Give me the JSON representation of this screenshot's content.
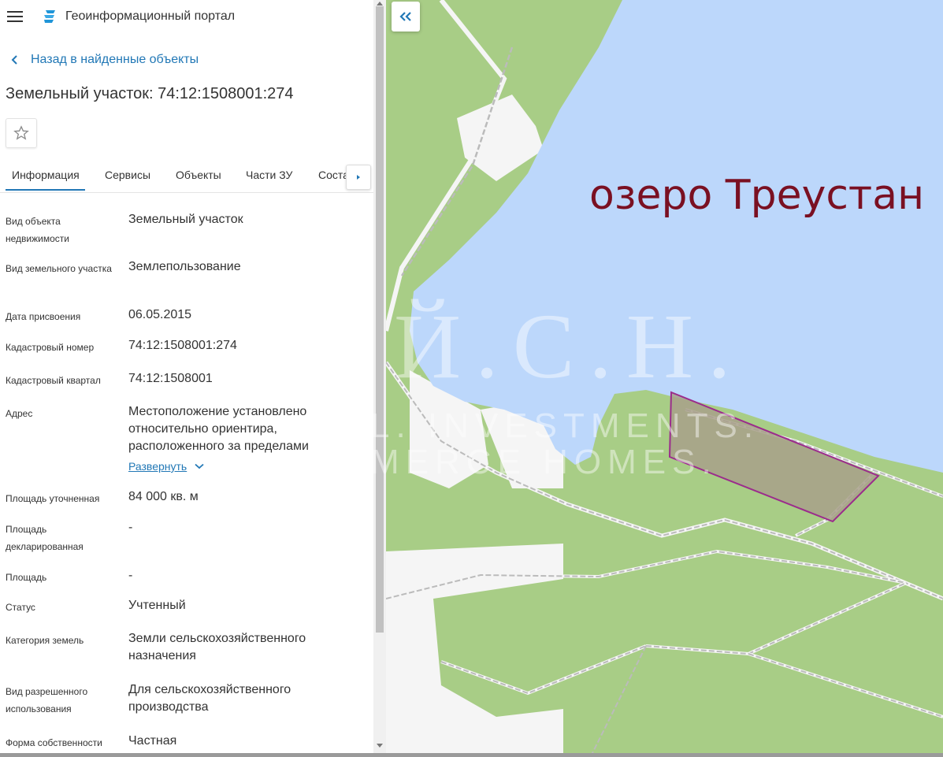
{
  "header": {
    "title": "Геоинформационный портал",
    "menu_icon": "hamburger-icon",
    "logo_icon": "portal-logo-icon"
  },
  "nav": {
    "back_label": "Назад в найденные объекты"
  },
  "object": {
    "title": "Земельный участок: 74:12:1508001:274"
  },
  "tabs": [
    {
      "label": "Информация",
      "active": true
    },
    {
      "label": "Сервисы"
    },
    {
      "label": "Объекты"
    },
    {
      "label": "Части ЗУ"
    },
    {
      "label": "Соста"
    }
  ],
  "fields": [
    {
      "label": "Вид объекта недвижимости",
      "value": "Земельный участок"
    },
    {
      "label": "Вид земельного участка",
      "value": "Землепользование"
    },
    {
      "label": "Дата присвоения",
      "value": "06.05.2015"
    },
    {
      "label": "Кадастровый номер",
      "value": "74:12:1508001:274"
    },
    {
      "label": "Кадастровый квартал",
      "value": "74:12:1508001"
    },
    {
      "label": "Адрес",
      "value": "Местоположение установлено относительно ориентира, расположенного за пределами"
    },
    {
      "label": "Площадь уточненная",
      "value": "84 000 кв. м"
    },
    {
      "label": "Площадь декларированная",
      "value": "-"
    },
    {
      "label": "Площадь",
      "value": "-"
    },
    {
      "label": "Статус",
      "value": "Учтенный"
    },
    {
      "label": "Категория земель",
      "value": "Земли сельскохозяйственного назначения"
    },
    {
      "label": "Вид разрешенного использования",
      "value": "Для сельскохозяйственного производства"
    },
    {
      "label": "Форма собственности",
      "value": "Частная"
    }
  ],
  "address_expand_label": "Развернуть",
  "map": {
    "lake_label": "озеро Треустан",
    "watermark_line1": "Й.С.Н.",
    "watermark_line2": "L. INVESTMENTS.",
    "watermark_line3": "MERCE HOMES.",
    "colors": {
      "water": "#bcd7fb",
      "forest": "#a8cd86",
      "open_land": "#f5f5f5",
      "parcel_fill": "#a8a08a",
      "parcel_border": "#9b2c8c",
      "lake_label": "#7a1022",
      "link": "#2278b6"
    }
  }
}
